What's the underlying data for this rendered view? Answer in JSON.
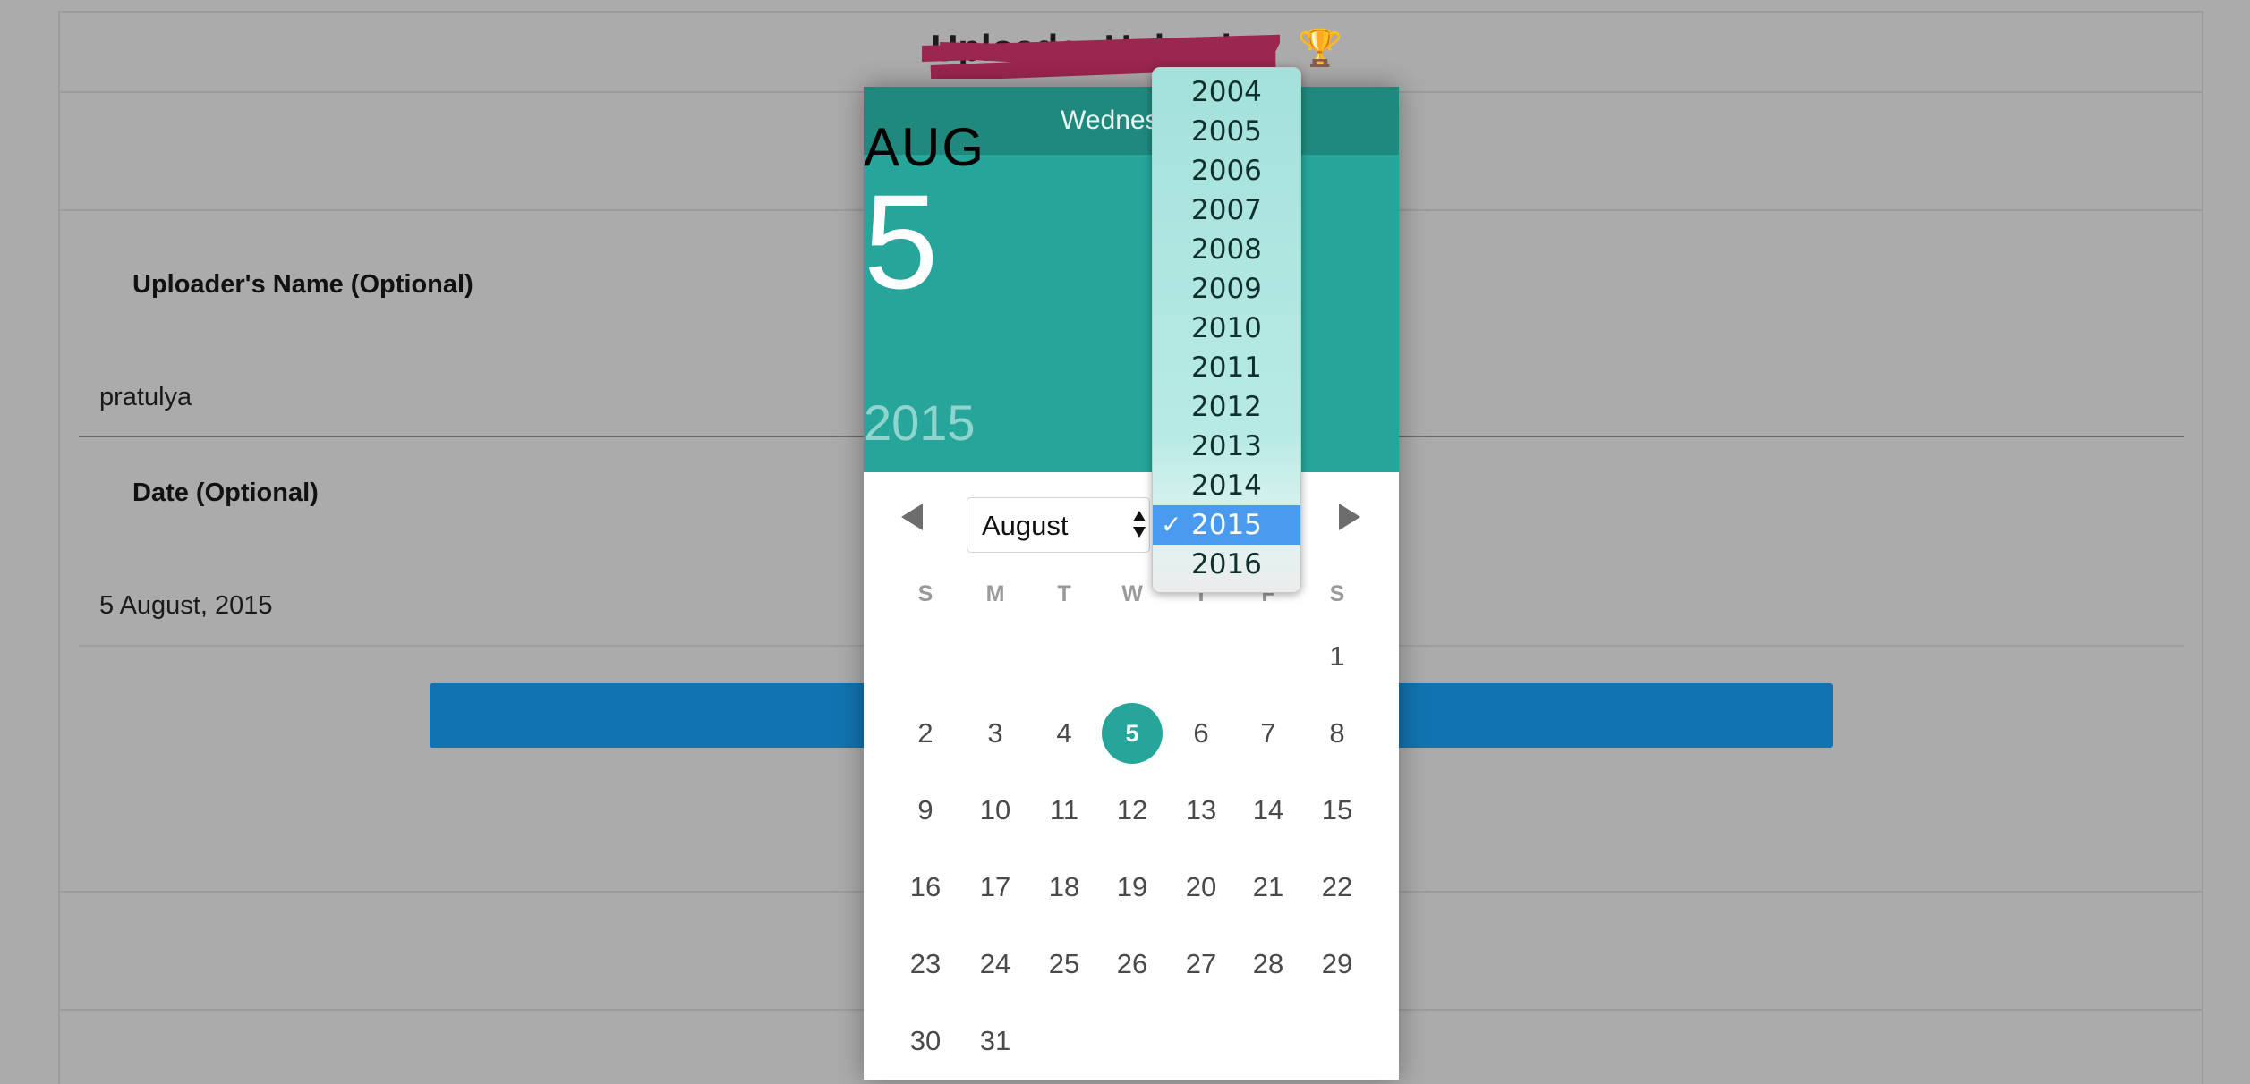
{
  "page": {
    "title": "Uploader Upload",
    "uploader_label": "Uploader's Name (Optional)",
    "uploader_value": "pratulya",
    "date_label": "Date (Optional)",
    "date_value": "5 August, 2015"
  },
  "picker": {
    "day_name": "Wednesday",
    "header_month": "AUG",
    "header_day": "5",
    "header_year": "2015",
    "month_select": "August",
    "weekdays": [
      "S",
      "M",
      "T",
      "W",
      "T",
      "F",
      "S"
    ],
    "selected_day": 5,
    "weeks": [
      [
        "",
        "",
        "",
        "",
        "",
        "",
        "1"
      ],
      [
        "2",
        "3",
        "4",
        "5",
        "6",
        "7",
        "8"
      ],
      [
        "9",
        "10",
        "11",
        "12",
        "13",
        "14",
        "15"
      ],
      [
        "16",
        "17",
        "18",
        "19",
        "20",
        "21",
        "22"
      ],
      [
        "23",
        "24",
        "25",
        "26",
        "27",
        "28",
        "29"
      ],
      [
        "30",
        "31",
        "",
        "",
        "",
        "",
        ""
      ]
    ]
  },
  "year_dropdown": {
    "options": [
      "2004",
      "2005",
      "2006",
      "2007",
      "2008",
      "2009",
      "2010",
      "2011",
      "2012",
      "2013",
      "2014",
      "2015",
      "2016"
    ],
    "selected": "2015",
    "check_glyph": "✓"
  },
  "colors": {
    "accent": "#26a69a",
    "accent_dark": "#1f897d",
    "submit_blue": "#1174b0",
    "dropdown_highlight": "#4a9bf0"
  }
}
